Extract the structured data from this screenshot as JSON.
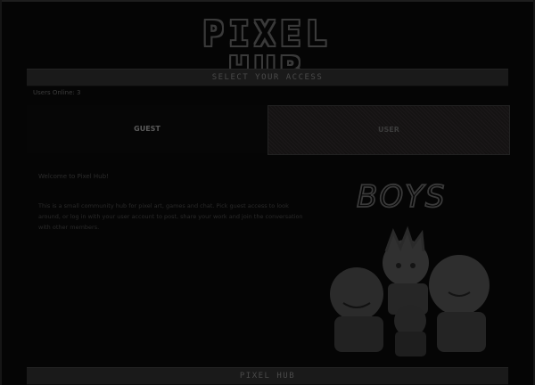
{
  "site": {
    "logo_text": "PIXEL HUB"
  },
  "banners": {
    "top": "SELECT YOUR ACCESS",
    "bottom": "PIXEL HUB"
  },
  "status": {
    "online_text": "Users Online: 3"
  },
  "login": {
    "guest_label": "GUEST",
    "user_label": "USER"
  },
  "content": {
    "welcome_heading": "Welcome to Pixel Hub!",
    "description": "This is a small community hub for pixel art, games and chat. Pick guest access to look around, or log in with your user account to post, share your work and join the conversation with other members."
  },
  "artwork": {
    "caption": "BOYS"
  },
  "colors": {
    "background": "#050505",
    "panel": "#1a1a1a",
    "text": "#3a3a3a"
  }
}
